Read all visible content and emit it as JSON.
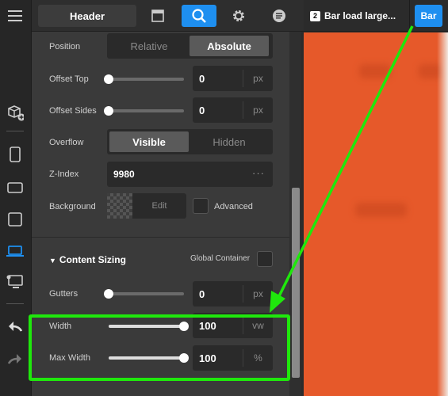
{
  "toolbar": {
    "header_label": "Header",
    "icons": [
      "menu-icon",
      "window-icon",
      "search-icon",
      "gear-icon",
      "list-icon"
    ]
  },
  "rail": {
    "icons": [
      "add-element-icon",
      "mobile-icon",
      "tablet-landscape-icon",
      "tablet-icon",
      "laptop-icon",
      "desktop-icon",
      "undo-icon",
      "redo-icon"
    ]
  },
  "panel": {
    "position": {
      "label": "Position",
      "options": [
        "Relative",
        "Absolute"
      ],
      "selected": "Absolute"
    },
    "offset_top": {
      "label": "Offset Top",
      "value": "0",
      "unit": "px",
      "slider": 0.0
    },
    "offset_sides": {
      "label": "Offset Sides",
      "value": "0",
      "unit": "px",
      "slider": 0.0
    },
    "overflow": {
      "label": "Overflow",
      "options": [
        "Visible",
        "Hidden"
      ],
      "selected": "Visible"
    },
    "z_index": {
      "label": "Z-Index",
      "value": "9980",
      "menu": "···"
    },
    "background": {
      "label": "Background",
      "edit_label": "Edit",
      "advanced_label": "Advanced"
    },
    "content_sizing": {
      "title": "Content Sizing",
      "global_label": "Global Container"
    },
    "gutters": {
      "label": "Gutters",
      "value": "0",
      "unit": "px",
      "slider": 0.0
    },
    "width": {
      "label": "Width",
      "value": "100",
      "unit": "vw",
      "slider": 1.0
    },
    "max_width": {
      "label": "Max Width",
      "value": "100",
      "unit": "%",
      "slider": 1.0
    }
  },
  "tabs": {
    "tab1_badge": "2",
    "tab1_label": "Bar load large...",
    "tab2_label": "Bar"
  },
  "colors": {
    "accent": "#1e8ff0",
    "canvas": "#e6592a",
    "highlight": "#1fe80c"
  }
}
